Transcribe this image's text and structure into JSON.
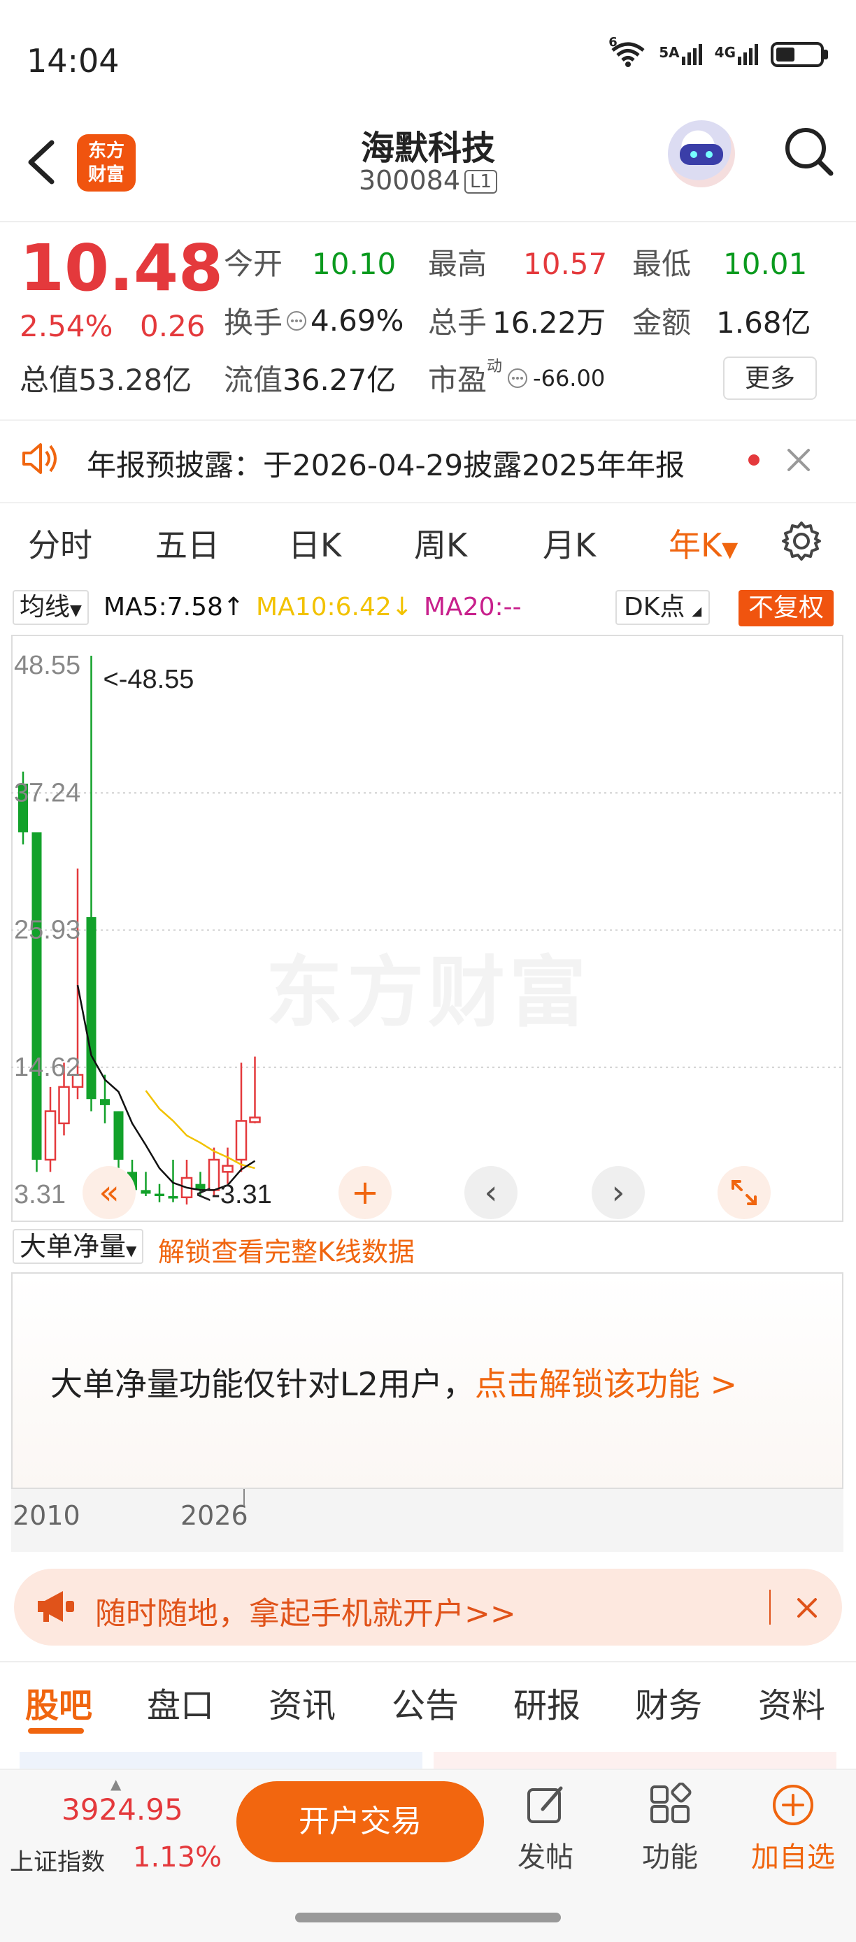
{
  "status_bar": {
    "time": "14:04",
    "wifi_badge": "6",
    "sim1": "5A",
    "sim2": "4G"
  },
  "header": {
    "logo_line1": "东方",
    "logo_line2": "财富",
    "stock_name": "海默科技",
    "stock_code": "300084",
    "level_badge": "L1"
  },
  "quote": {
    "price": "10.48",
    "change_pct": "2.54%",
    "change_abs": "0.26",
    "market_value": "总值53.28亿",
    "fields": [
      {
        "label": "今开",
        "value": "10.10",
        "color": "#0a9a1e"
      },
      {
        "label": "最高",
        "value": "10.57",
        "color": "#e4393c"
      },
      {
        "label": "最低",
        "value": "10.01",
        "color": "#0a9a1e"
      },
      {
        "label": "换手",
        "value": "4.69%",
        "color": "#222222"
      },
      {
        "label": "总手",
        "value": "16.22万",
        "color": "#222222"
      },
      {
        "label": "金额",
        "value": "1.68亿",
        "color": "#222222"
      },
      {
        "label": "流值",
        "value": "36.27亿",
        "color": "#222222"
      },
      {
        "label": "市盈",
        "superscript": "动",
        "value": "-66.00",
        "color": "#222222"
      }
    ],
    "more_label": "更多"
  },
  "notice": {
    "text": "年报预披露：于2026-04-29披露2025年年报"
  },
  "kline_tabs": [
    "分时",
    "五日",
    "日K",
    "周K",
    "月K",
    "年K"
  ],
  "active_tab": "年K",
  "indicator": {
    "ma_selector": "均线",
    "ma5": "MA5:7.58",
    "ma10": "MA10:6.42",
    "ma20": "MA20:--",
    "dk_label": "DK点",
    "adjust_label": "不复权",
    "ma5_color": "#111111",
    "ma10_color": "#f2c200",
    "ma20_color": "#c8208c"
  },
  "chart_data": {
    "type": "candlestick",
    "y_ticks": [
      "48.55",
      "37.24",
      "25.93",
      "14.62",
      "3.31"
    ],
    "ylim": [
      3.31,
      48.55
    ],
    "max_label": "<-48.55",
    "min_label": "<-3.31",
    "watermark": "东方财富",
    "x_ticks": [
      "2010",
      "2026"
    ],
    "candles": [
      {
        "open": 38,
        "close": 34,
        "high": 39,
        "low": 33
      },
      {
        "open": 34,
        "close": 7,
        "high": 34,
        "low": 6
      },
      {
        "open": 7,
        "close": 11,
        "high": 13,
        "low": 6
      },
      {
        "open": 10,
        "close": 13,
        "high": 15,
        "low": 9
      },
      {
        "open": 13,
        "close": 14,
        "high": 31,
        "low": 12
      },
      {
        "open": 27,
        "close": 12,
        "high": 48.55,
        "low": 11
      },
      {
        "open": 12,
        "close": 11.5,
        "high": 14,
        "low": 10
      },
      {
        "open": 11,
        "close": 7,
        "high": 11,
        "low": 6
      },
      {
        "open": 6,
        "close": 4.5,
        "high": 7,
        "low": 4
      },
      {
        "open": 4.5,
        "close": 4.2,
        "high": 6,
        "low": 4
      },
      {
        "open": 4.2,
        "close": 4,
        "high": 5,
        "low": 3.5
      },
      {
        "open": 4,
        "close": 3.8,
        "high": 7,
        "low": 3.5
      },
      {
        "open": 3.9,
        "close": 5.5,
        "high": 7,
        "low": 3.31
      },
      {
        "open": 5,
        "close": 4.5,
        "high": 6,
        "low": 4
      },
      {
        "open": 4.5,
        "close": 7,
        "high": 8,
        "low": 4
      },
      {
        "open": 6,
        "close": 6.5,
        "high": 8,
        "low": 5
      },
      {
        "open": 7,
        "close": 10.2,
        "high": 15,
        "low": 6
      },
      {
        "open": 10.1,
        "close": 10.48,
        "high": 15.5,
        "low": 10
      }
    ],
    "ma5": [
      null,
      null,
      null,
      null,
      21.4,
      15.6,
      13.6,
      12.6,
      10.0,
      8.2,
      6.3,
      5.1,
      4.7,
      4.5,
      4.5,
      4.9,
      6.2,
      6.9
    ],
    "ma10": [
      null,
      null,
      null,
      null,
      null,
      null,
      null,
      null,
      null,
      12.7,
      11.2,
      10.2,
      9.0,
      8.4,
      7.7,
      7.2,
      6.6,
      6.3
    ],
    "ctrl_icons": [
      "double-left-icon",
      "plus-icon",
      "chevron-left-icon",
      "chevron-right-icon",
      "expand-icon"
    ]
  },
  "volume_section": {
    "selector": "大单净量",
    "unlock_link": "解锁查看完整K线数据",
    "l2_text": "大单净量功能仅针对L2用户，",
    "l2_link": "点击解锁该功能 >"
  },
  "open_banner": {
    "text": "随时随地，拿起手机就开户>>"
  },
  "bottom_tabs": [
    "股吧",
    "盘口",
    "资讯",
    "公告",
    "研报",
    "财务",
    "资料"
  ],
  "tabbar": {
    "index_value": "3924.95",
    "index_name": "上证指数",
    "index_pct": "1.13%",
    "trade_button": "开户交易",
    "post": "发帖",
    "function": "功能",
    "add_watch": "加自选"
  }
}
